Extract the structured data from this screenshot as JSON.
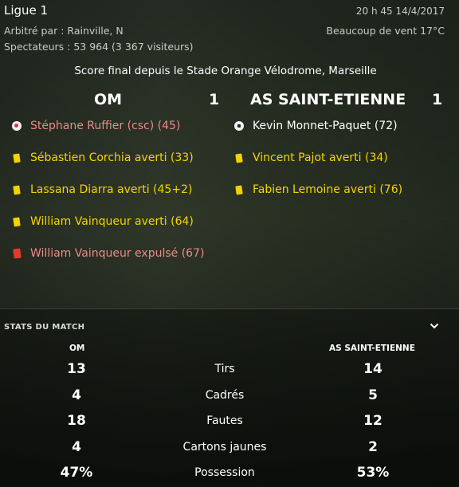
{
  "header": {
    "league": "Ligue 1",
    "datetime": "20 h 45 14/4/2017",
    "referee": "Arbitré par : Rainville, N",
    "spectators": "Spectateurs : 53 964 (3 367 visiteurs)",
    "weather": "Beaucoup de vent 17°C"
  },
  "headline": "Score final depuis le Stade Orange Vélodrome, Marseille",
  "match": {
    "home_team": "OM",
    "home_score": "1",
    "away_team": "AS SAINT-ETIENNE",
    "away_score": "1"
  },
  "home_events": [
    {
      "icon": "own-goal-ball-icon",
      "text": "Stéphane Ruffier (csc) (45)",
      "color": "#ec8a86"
    },
    {
      "icon": "yellow-card-icon",
      "text": "Sébastien Corchia averti (33)",
      "color": "#f2d600"
    },
    {
      "icon": "yellow-card-icon",
      "text": "Lassana Diarra averti (45+2)",
      "color": "#f2d600"
    },
    {
      "icon": "yellow-card-icon",
      "text": "William Vainqueur averti (64)",
      "color": "#f2d600"
    },
    {
      "icon": "red-card-icon",
      "text": "William Vainqueur expulsé (67)",
      "color": "#ec8a86"
    }
  ],
  "away_events": [
    {
      "icon": "goal-ball-icon",
      "text": "Kevin Monnet-Paquet (72)",
      "color": "#ffffff"
    },
    {
      "icon": "yellow-card-icon",
      "text": "Vincent Pajot averti (34)",
      "color": "#f2d600"
    },
    {
      "icon": "yellow-card-icon",
      "text": "Fabien Lemoine averti (76)",
      "color": "#f2d600"
    }
  ],
  "stats": {
    "title": "STATS DU MATCH",
    "home_header": "OM",
    "away_header": "AS SAINT-ETIENNE",
    "rows": [
      {
        "label": "Tirs",
        "home": "13",
        "away": "14"
      },
      {
        "label": "Cadrés",
        "home": "4",
        "away": "5"
      },
      {
        "label": "Fautes",
        "home": "18",
        "away": "12"
      },
      {
        "label": "Cartons jaunes",
        "home": "4",
        "away": "2"
      },
      {
        "label": "Possession",
        "home": "47%",
        "away": "53%"
      }
    ]
  }
}
